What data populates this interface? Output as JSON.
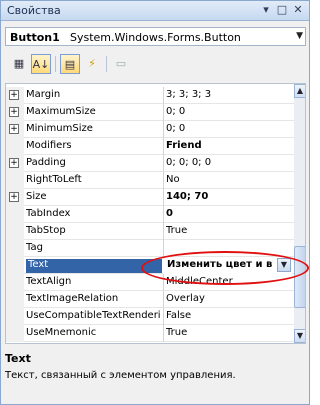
{
  "window": {
    "title": "Свойства",
    "controls": [
      "▾",
      "□",
      "✕"
    ]
  },
  "object_selector": {
    "name": "Button1",
    "type": "System.Windows.Forms.Button"
  },
  "toolbar": {
    "buttons": [
      {
        "icon": "categorized-icon",
        "glyph": "▦",
        "active": false
      },
      {
        "icon": "alphabetical-icon",
        "glyph": "A↓",
        "active": true
      },
      {
        "icon": "properties-icon",
        "glyph": "▤",
        "active": true
      },
      {
        "icon": "events-icon",
        "glyph": "⚡",
        "active": false
      },
      {
        "icon": "property-pages-icon",
        "glyph": "▭",
        "active": false
      }
    ]
  },
  "grid": {
    "rows": [
      {
        "name": "Margin",
        "value": "3; 3; 3; 3",
        "expandable": true,
        "bold": false
      },
      {
        "name": "MaximumSize",
        "value": "0; 0",
        "expandable": true,
        "bold": false
      },
      {
        "name": "MinimumSize",
        "value": "0; 0",
        "expandable": true,
        "bold": false
      },
      {
        "name": "Modifiers",
        "value": "Friend",
        "expandable": false,
        "bold": true
      },
      {
        "name": "Padding",
        "value": "0; 0; 0; 0",
        "expandable": true,
        "bold": false
      },
      {
        "name": "RightToLeft",
        "value": "No",
        "expandable": false,
        "bold": false
      },
      {
        "name": "Size",
        "value": "140; 70",
        "expandable": true,
        "bold": true
      },
      {
        "name": "TabIndex",
        "value": "0",
        "expandable": false,
        "bold": true
      },
      {
        "name": "TabStop",
        "value": "True",
        "expandable": false,
        "bold": false
      },
      {
        "name": "Tag",
        "value": "",
        "expandable": false,
        "bold": false
      },
      {
        "name": "Text",
        "value": "Изменить цвет и в",
        "expandable": false,
        "bold": true,
        "selected": true
      },
      {
        "name": "TextAlign",
        "value": "MiddleCenter",
        "expandable": false,
        "bold": false
      },
      {
        "name": "TextImageRelation",
        "value": "Overlay",
        "expandable": false,
        "bold": false
      },
      {
        "name": "UseCompatibleTextRenderi",
        "value": "False",
        "expandable": false,
        "bold": false
      },
      {
        "name": "UseMnemonic",
        "value": "True",
        "expandable": false,
        "bold": false
      }
    ]
  },
  "description": {
    "title": "Text",
    "text": "Текст, связанный с элементом управления."
  },
  "colors": {
    "selection": "#3464a8",
    "annotation": "#e10f0f",
    "titlebar": "#c6d9f0"
  }
}
